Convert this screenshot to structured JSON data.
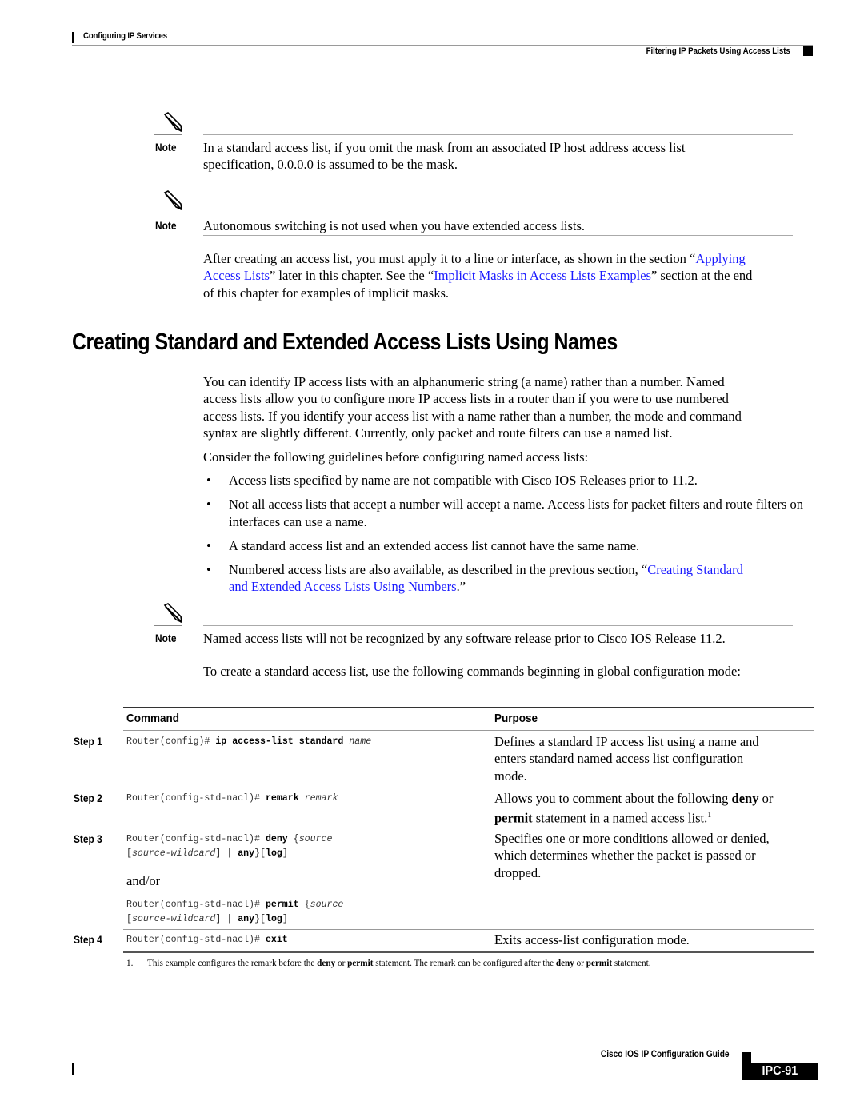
{
  "header": {
    "chapter": "Configuring IP Services",
    "section": "Filtering IP Packets Using Access Lists"
  },
  "notes": [
    {
      "label": "Note",
      "icon": "pencil-note-icon",
      "lines": [
        "In a standard access list, if you omit the mask from an associated IP host address access list",
        "specification, 0.0.0.0 is assumed to be the mask."
      ]
    },
    {
      "label": "Note",
      "icon": "pencil-note-icon",
      "lines": [
        "Autonomous switching is not used when you have extended access lists."
      ]
    },
    {
      "label": "Note",
      "icon": "pencil-note-icon",
      "lines": [
        "Named access lists will not be recognized by any software release prior to Cisco IOS Release 11.2."
      ]
    }
  ],
  "after_para": {
    "t1": "After creating an access list, you must apply it to a line or interface, as shown in the section “",
    "link1a": "Applying",
    "link1b": "Access Lists",
    "t2": "” later in this chapter. See the “",
    "link2": "Implicit Masks in Access Lists Examples",
    "t3": "” section at the end",
    "t4": "of this chapter for examples of implicit masks."
  },
  "section_title": "Creating Standard and Extended Access Lists Using Names",
  "intro_lines": [
    "You can identify IP access lists with an alphanumeric string (a name) rather than a number. Named",
    "access lists allow you to configure more IP access lists in a router than if you were to use numbered",
    "access lists. If you identify your access list with a name rather than a number, the mode and command",
    "syntax are slightly different. Currently, only packet and route filters can use a named list."
  ],
  "guidelines_intro": "Consider the following guidelines before configuring named access lists:",
  "guidelines": [
    {
      "text": "Access lists specified by name are not compatible with Cisco IOS Releases prior to 11.2."
    },
    {
      "text": "Not all access lists that accept a number will accept a name. Access lists for packet filters and route filters on interfaces can use a name."
    },
    {
      "text": "A standard access list and an extended access list cannot have the same name."
    }
  ],
  "guideline_link_item": {
    "pre": "Numbered access lists are also available, as described in the previous section, “",
    "link_a": "Creating Standard",
    "link_b": "and Extended Access Lists Using Numbers",
    "post": ".”"
  },
  "table_intro": "To create a standard access list, use the following commands beginning in global configuration mode:",
  "table": {
    "headers": {
      "command": "Command",
      "purpose": "Purpose"
    },
    "steps": [
      {
        "step": "Step 1",
        "prompt": "Router(config)# ",
        "keyword": "ip access-list standard",
        "arg": "name",
        "purpose": [
          "Defines a standard IP access list using a name and",
          "enters standard named access list configuration",
          "mode."
        ]
      },
      {
        "step": "Step 2",
        "prompt": "Router(config-std-nacl)# ",
        "keyword": "remark",
        "arg": "remark",
        "purpose_pre": "Allows you to comment about the following ",
        "purpose_b1": "deny",
        "purpose_mid": " or",
        "purpose_b2": "permit",
        "purpose_post": " statement in a named access list.",
        "footnote_ref": "1"
      },
      {
        "step": "Step 3",
        "deny_line1": {
          "prompt": "Router(config-std-nacl)# ",
          "keyword": "deny",
          "rest": " {",
          "arg": "source"
        },
        "line2": {
          "open": "[",
          "arg": "source-wildcard",
          "mid": "] | ",
          "any": "any",
          "close": "}[",
          "log": "log",
          "end": "]"
        },
        "andor": "and/or",
        "permit_line1": {
          "prompt": "Router(config-std-nacl)# ",
          "keyword": "permit",
          "rest": " {",
          "arg": "source"
        },
        "purpose": [
          "Specifies one or more conditions allowed or denied,",
          "which determines whether the packet is passed or",
          "dropped."
        ]
      },
      {
        "step": "Step 4",
        "prompt": "Router(config-std-nacl)# ",
        "keyword": "exit",
        "purpose": [
          "Exits access-list configuration mode."
        ]
      }
    ]
  },
  "footnote": {
    "num": "1.",
    "t1": "This example configures the remark before the ",
    "b1": "deny",
    "t2": " or ",
    "b2": "permit",
    "t3": " statement. The remark can be configured after the ",
    "b3": "deny",
    "t4": " or ",
    "b4": "permit",
    "t5": " statement."
  },
  "footer": {
    "guide_title": "Cisco IOS IP Configuration Guide",
    "page": "IPC-91"
  },
  "colors": {
    "link": "#1a1aff",
    "text": "#000000",
    "rule": "#aaaaaa"
  }
}
